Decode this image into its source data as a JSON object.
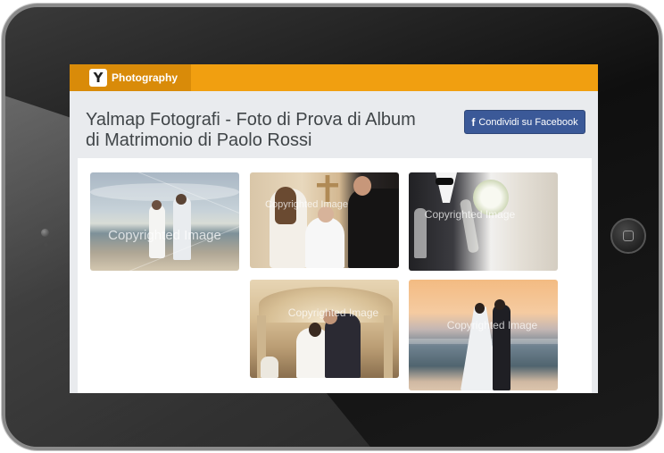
{
  "app": {
    "brand_name": "Photography",
    "logo_letter": "Y"
  },
  "header": {
    "title": "Yalmap Fotografi - Foto di Prova di Album di Matrimonio di Paolo Rossi",
    "share_button": {
      "icon": "f",
      "label": "Condividi su Facebook"
    }
  },
  "gallery": {
    "photos": [
      {
        "watermark": "Copyrighted Image"
      },
      {
        "watermark": "Copyrighted Image"
      },
      {
        "watermark": "Copyrighted Image"
      },
      {
        "watermark": "Copyrighted Image"
      },
      {
        "watermark": "Copyrighted Image"
      }
    ]
  },
  "colors": {
    "topbar": "#f19f10",
    "brand_block": "#d98b09",
    "facebook": "#3b5998",
    "page_bg": "#e9ebee",
    "title_text": "#404548"
  }
}
